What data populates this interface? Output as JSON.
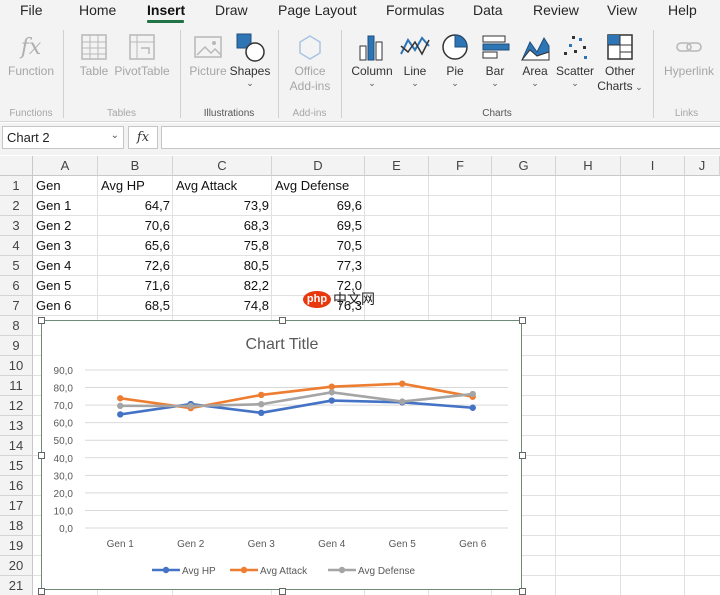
{
  "tabs": [
    {
      "label": "File",
      "active": false
    },
    {
      "label": "Home",
      "active": false
    },
    {
      "label": "Insert",
      "active": true
    },
    {
      "label": "Draw",
      "active": false
    },
    {
      "label": "Page Layout",
      "active": false
    },
    {
      "label": "Formulas",
      "active": false
    },
    {
      "label": "Data",
      "active": false
    },
    {
      "label": "Review",
      "active": false
    },
    {
      "label": "View",
      "active": false
    },
    {
      "label": "Help",
      "active": false
    }
  ],
  "ribbon": {
    "function": {
      "label": "Function"
    },
    "table": {
      "label": "Table"
    },
    "pivottable": {
      "label": "PivotTable"
    },
    "picture": {
      "label": "Picture"
    },
    "shapes": {
      "label": "Shapes"
    },
    "office_addins": {
      "label1": "Office",
      "label2": "Add-ins"
    },
    "column": {
      "label": "Column"
    },
    "line": {
      "label": "Line"
    },
    "pie": {
      "label": "Pie"
    },
    "bar": {
      "label": "Bar"
    },
    "area": {
      "label": "Area"
    },
    "scatter": {
      "label": "Scatter"
    },
    "other_charts": {
      "label1": "Other",
      "label2": "Charts"
    },
    "hyperlink": {
      "label": "Hyperlink"
    },
    "groups": {
      "functions": "Functions",
      "tables": "Tables",
      "illustrations": "Illustrations",
      "addins": "Add-ins",
      "charts": "Charts",
      "links": "Links"
    }
  },
  "formula_bar": {
    "name_box": "Chart 2",
    "fx": "fx",
    "formula": ""
  },
  "columns": [
    "A",
    "B",
    "C",
    "D",
    "E",
    "F",
    "G",
    "H",
    "I",
    "J"
  ],
  "rows": [
    "1",
    "2",
    "3",
    "4",
    "5",
    "6",
    "7",
    "8",
    "9",
    "10",
    "11",
    "12",
    "13",
    "14",
    "15",
    "16",
    "17",
    "18",
    "19",
    "20",
    "21"
  ],
  "sheet": {
    "headers": [
      "Gen",
      "Avg HP",
      "Avg Attack",
      "Avg Defense"
    ],
    "data": [
      [
        "Gen 1",
        "64,7",
        "73,9",
        "69,6"
      ],
      [
        "Gen 2",
        "70,6",
        "68,3",
        "69,5"
      ],
      [
        "Gen 3",
        "65,6",
        "75,8",
        "70,5"
      ],
      [
        "Gen 4",
        "72,6",
        "80,5",
        "77,3"
      ],
      [
        "Gen 5",
        "71,6",
        "82,2",
        "72,0"
      ],
      [
        "Gen 6",
        "68,5",
        "74,8",
        "76,3"
      ]
    ]
  },
  "watermark": "php中文网",
  "colors": {
    "accent": "#217346",
    "hp": "#4472c4",
    "attack": "#ed7d31",
    "defense": "#a5a5a5"
  },
  "chart_data": {
    "type": "line",
    "title": "Chart Title",
    "categories": [
      "Gen 1",
      "Gen 2",
      "Gen 3",
      "Gen 4",
      "Gen 5",
      "Gen 6"
    ],
    "series": [
      {
        "name": "Avg HP",
        "values": [
          64.7,
          70.6,
          65.6,
          72.6,
          71.6,
          68.5
        ],
        "color": "#4472c4"
      },
      {
        "name": "Avg Attack",
        "values": [
          73.9,
          68.3,
          75.8,
          80.5,
          82.2,
          74.8
        ],
        "color": "#ed7d31"
      },
      {
        "name": "Avg Defense",
        "values": [
          69.6,
          69.5,
          70.5,
          77.3,
          72.0,
          76.3
        ],
        "color": "#a5a5a5"
      }
    ],
    "yticks": [
      "0,0",
      "10,0",
      "20,0",
      "30,0",
      "40,0",
      "50,0",
      "60,0",
      "70,0",
      "80,0",
      "90,0"
    ],
    "ylim": [
      0,
      90
    ],
    "grid": true,
    "legend": "bottom"
  }
}
